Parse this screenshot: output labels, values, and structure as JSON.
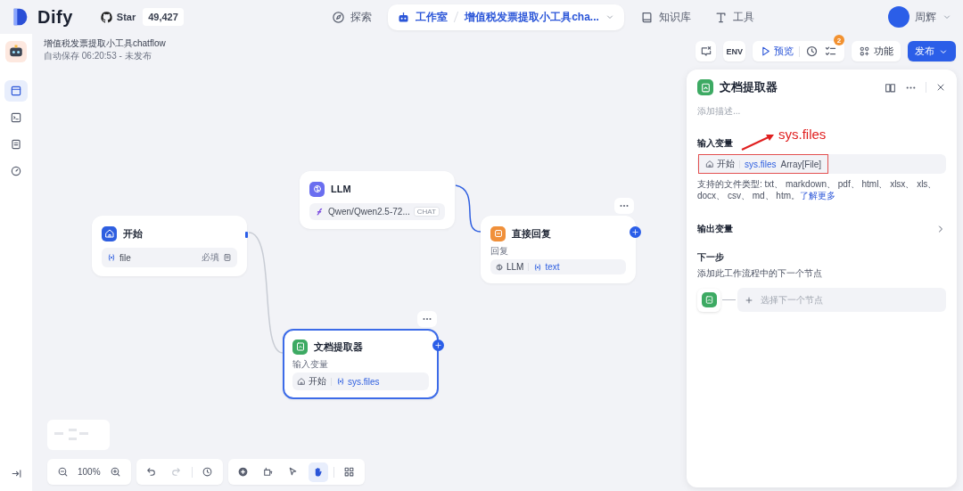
{
  "header": {
    "logo": "Dify",
    "github": {
      "label": "Star",
      "count": "49,427"
    },
    "nav": [
      {
        "label": "探索",
        "selected": false
      },
      {
        "label": "工作室",
        "selected": true,
        "breadcrumb": "增值税发票提取小工具cha..."
      },
      {
        "label": "知识库",
        "selected": false
      },
      {
        "label": "工具",
        "selected": false
      }
    ],
    "user": {
      "name": "周辉"
    }
  },
  "sidebar": {
    "items": [
      {
        "selected": true
      },
      {
        "selected": false
      },
      {
        "selected": false
      },
      {
        "selected": false
      }
    ]
  },
  "app": {
    "title": "增值税发票提取小工具chatflow",
    "status": "自动保存 06:20:53 - 未发布"
  },
  "toolbar": {
    "env": "ENV",
    "preview": "预览",
    "checklist_badge": "2",
    "features": "功能",
    "publish": "发布"
  },
  "nodes": [
    {
      "kind": "start",
      "title": "开始",
      "selected": false,
      "actions_visible": false,
      "variable": "file",
      "required": "必填"
    },
    {
      "kind": "llm",
      "title": "LLM",
      "selected": false,
      "actions_visible": false,
      "model": "Qwen/Qwen2.5-72...",
      "mode": "CHAT"
    },
    {
      "kind": "answer",
      "title": "直接回复",
      "selected": false,
      "actions_visible": true,
      "label": "回复",
      "source": "LLM",
      "variable": "text"
    },
    {
      "kind": "doc",
      "title": "文档提取器",
      "selected": true,
      "actions_visible": true,
      "label": "输入变量",
      "source": "开始",
      "variable": "sys.files"
    }
  ],
  "panel": {
    "title": "文档提取器",
    "description_placeholder": "添加描述...",
    "input_heading": "输入变量",
    "input": {
      "source": "开始",
      "variable": "sys.files",
      "type": "Array[File]"
    },
    "annotation": {
      "text": "sys.files"
    },
    "note": "支持的文件类型: txt、 markdown、 pdf、 html、 xlsx、 xls、 docx、 csv、 md、 htm。",
    "note_link": "了解更多",
    "output_heading": "输出变量",
    "next_heading": "下一步",
    "next_description": "添加此工作流程中的下一个节点",
    "next_placeholder": "选择下一个节点"
  },
  "controls": {
    "zoom": "100%",
    "modes": [
      {
        "kind": "pointer",
        "selected": false
      },
      {
        "kind": "hand",
        "selected": true
      }
    ]
  }
}
